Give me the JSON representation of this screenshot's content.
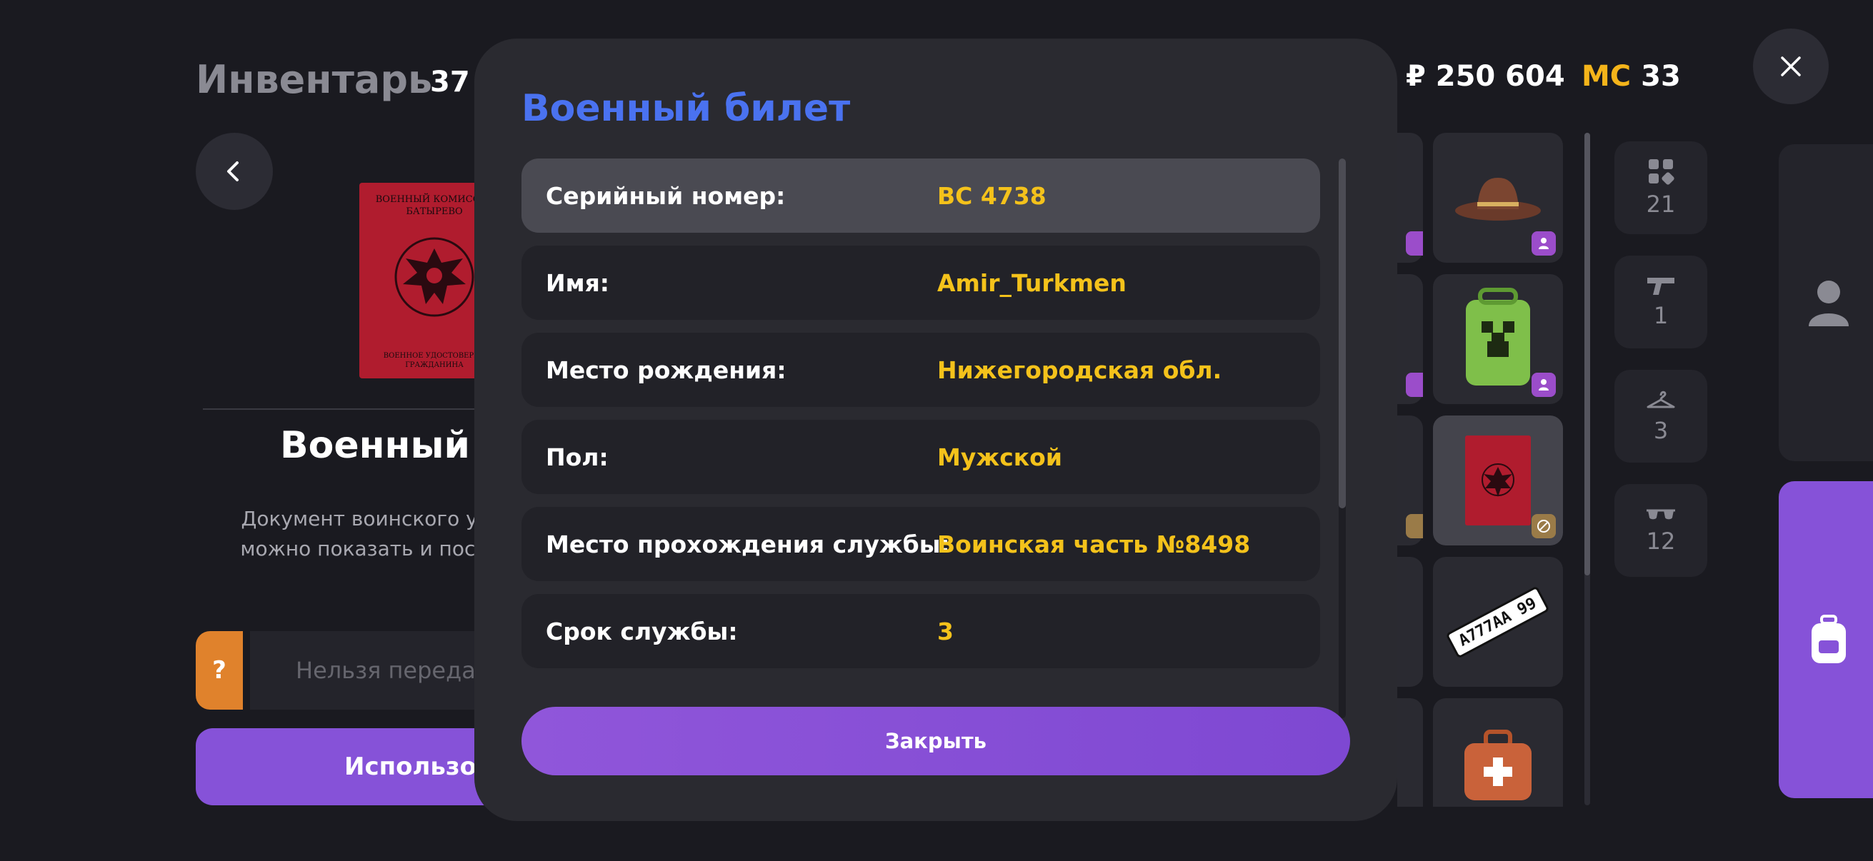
{
  "inventory": {
    "title": "Инвентарь",
    "count": "37 /",
    "item_name": "Военный б",
    "item_description": "Документ воинского учё можно показать и посмо",
    "help_label": "?",
    "transfer_label": "Нельзя переда",
    "use_label": "Использов",
    "preview_top_text": "ВОЕННЫЙ КОМИССАР БАТЫРЕВО",
    "preview_bottom_text": "ВОЕННОЕ УДОСТОВЕРЕН ГРАЖДАНИНА"
  },
  "currency": {
    "rub": "₽ 250 604",
    "mc_label": "MC",
    "mc_value": "33"
  },
  "categories": [
    {
      "icon": "grid-icon",
      "count": "21"
    },
    {
      "icon": "pistol-icon",
      "count": "1"
    },
    {
      "icon": "hanger-icon",
      "count": "3"
    },
    {
      "icon": "glasses-icon",
      "count": "12"
    }
  ],
  "plate_text": "А777АА 99",
  "modal": {
    "title": "Военный билет",
    "rows": [
      {
        "label": "Серийный номер:",
        "value": "BC 4738"
      },
      {
        "label": "Имя:",
        "value": "Amir_Turkmen"
      },
      {
        "label": "Место рождения:",
        "value": "Нижегородская обл."
      },
      {
        "label": "Пол:",
        "value": "Мужской"
      },
      {
        "label": "Место прохождения службы:",
        "value": "Воинская часть №8498"
      },
      {
        "label": "Срок службы:",
        "value": "3"
      }
    ],
    "close_label": "Закрыть"
  },
  "colors": {
    "accent_purple": "#8652d8",
    "title_blue": "#4a72f0",
    "value_yellow": "#f4c21b",
    "mc_gold": "#f4b41a",
    "help_orange": "#e0822c"
  }
}
